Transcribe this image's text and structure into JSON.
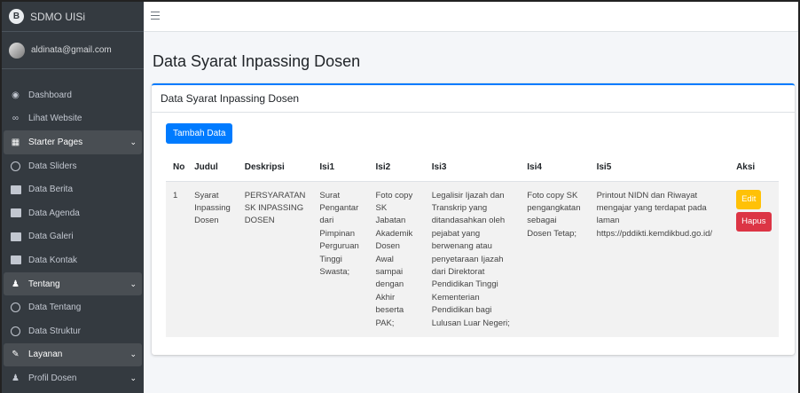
{
  "brand": {
    "title": "SDMO UISi",
    "logo": "B"
  },
  "user": {
    "email": "aldinata@gmail.com"
  },
  "sidebar": {
    "items": [
      {
        "label": "Dashboard",
        "icon": "dashboard-icon"
      },
      {
        "label": "Lihat Website",
        "icon": "link-icon"
      },
      {
        "label": "Starter Pages",
        "icon": "grid-icon"
      },
      {
        "label": "Data Sliders",
        "icon": "circle-icon"
      },
      {
        "label": "Data Berita",
        "icon": "image-icon"
      },
      {
        "label": "Data Agenda",
        "icon": "calendar-icon"
      },
      {
        "label": "Data Galeri",
        "icon": "gallery-icon"
      },
      {
        "label": "Data Kontak",
        "icon": "contact-icon"
      },
      {
        "label": "Tentang",
        "icon": "user-icon"
      },
      {
        "label": "Data Tentang",
        "icon": "circle-icon"
      },
      {
        "label": "Data Struktur",
        "icon": "circle-icon"
      },
      {
        "label": "Layanan",
        "icon": "edit-icon"
      },
      {
        "label": "Profil Dosen",
        "icon": "user-icon"
      }
    ]
  },
  "main": {
    "page_title": "Data Syarat Inpassing Dosen",
    "card_title": "Data Syarat Inpassing Dosen",
    "add_button": "Tambah Data",
    "table": {
      "headers": [
        "No",
        "Judul",
        "Deskripsi",
        "Isi1",
        "Isi2",
        "Isi3",
        "Isi4",
        "Isi5",
        "Aksi"
      ],
      "rows": [
        {
          "no": "1",
          "judul": "Syarat Inpassing Dosen",
          "deskripsi": "PERSYARATAN SK INPASSING DOSEN",
          "isi1": "Surat Pengantar dari Pimpinan Perguruan Tinggi Swasta;",
          "isi2": "Foto copy SK Jabatan Akademik Dosen Awal sampai dengan Akhir beserta PAK;",
          "isi3": "Legalisir Ijazah dan Transkrip yang ditandasahkan oleh pejabat yang berwenang atau penyetaraan Ijazah dari Direktorat Pendidikan Tinggi Kementerian Pendidikan bagi Lulusan Luar Negeri;",
          "isi4": "Foto copy SK pengangkatan sebagai Dosen Tetap;",
          "isi5": "Printout NIDN dan Riwayat mengajar yang terdapat pada laman https://pddikti.kemdikbud.go.id/",
          "edit": "Edit",
          "hapus": "Hapus"
        }
      ]
    }
  },
  "colors": {
    "sidebar": "#343a40",
    "primary": "#007bff",
    "warning": "#ffc107",
    "danger": "#dc3545"
  }
}
